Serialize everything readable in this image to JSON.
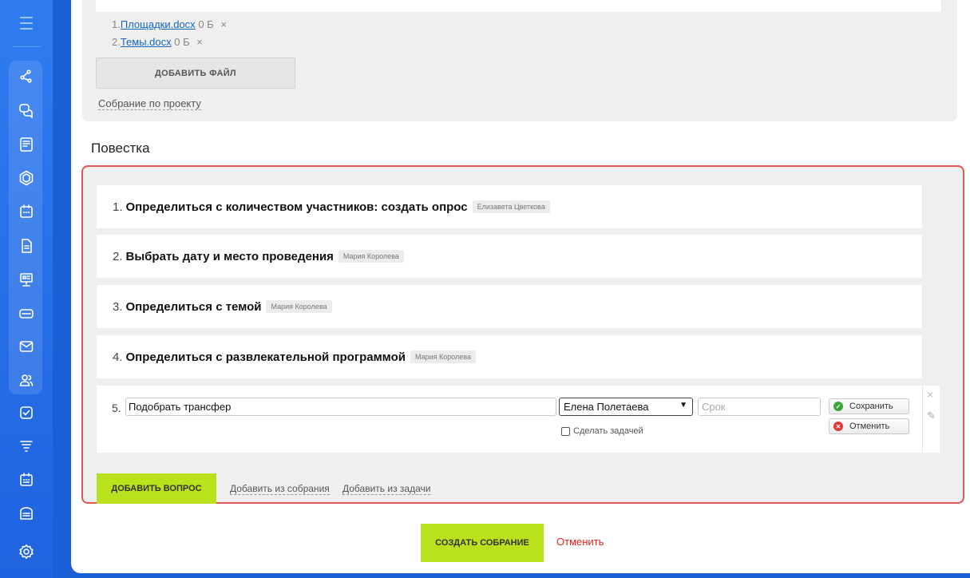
{
  "sidebar": {
    "icons": [
      "menu-icon",
      "workflow-icon",
      "chat-icon",
      "news-icon",
      "hexagon-icon",
      "calendar-icon",
      "document-icon",
      "presentation-icon",
      "drive-icon",
      "mail-icon",
      "users-icon",
      "checkbox-icon",
      "filter-icon",
      "schedule-icon",
      "building-icon",
      "settings-icon"
    ]
  },
  "files": [
    {
      "index": "1.",
      "name": "Площадки.docx",
      "size": "0 Б",
      "remove": "×"
    },
    {
      "index": "2.",
      "name": "Темы.docx",
      "size": "0 Б",
      "remove": "×"
    }
  ],
  "add_file_label": "ДОБАВИТЬ ФАЙЛ",
  "project_link": "Собрание по проекту",
  "agenda": {
    "title": "Повестка",
    "items": [
      {
        "num": "1.",
        "text": "Определиться с количеством участников: создать опрос",
        "person": "Елизавета Цветкова"
      },
      {
        "num": "2.",
        "text": "Выбрать дату и место проведения",
        "person": "Мария Королева"
      },
      {
        "num": "3.",
        "text": "Определиться с темой",
        "person": "Мария Королева"
      },
      {
        "num": "4.",
        "text": "Определиться с развлекательной программой",
        "person": "Мария Королева"
      }
    ],
    "edit_item": {
      "num": "5.",
      "value": "Подобрать трансфер",
      "responsible": "Елена Полетаева",
      "deadline_placeholder": "Срок",
      "make_task_label": "Сделать задачей",
      "save_label": "Сохранить",
      "cancel_label": "Отменить",
      "close_symbol": "×",
      "pencil_symbol": "✎"
    },
    "add_question_label": "ДОБАВИТЬ ВОПРОС",
    "add_from_meeting": "Добавить из собрания",
    "add_from_task": "Добавить из задачи"
  },
  "footer": {
    "create_label": "СОЗДАТЬ СОБРАНИЕ",
    "cancel_label": "Отменить"
  },
  "colors": {
    "accent_green": "#b9e21c",
    "highlight_red": "#e05555",
    "sidebar_blue": "#1f63e0",
    "link_blue": "#1565c0"
  }
}
